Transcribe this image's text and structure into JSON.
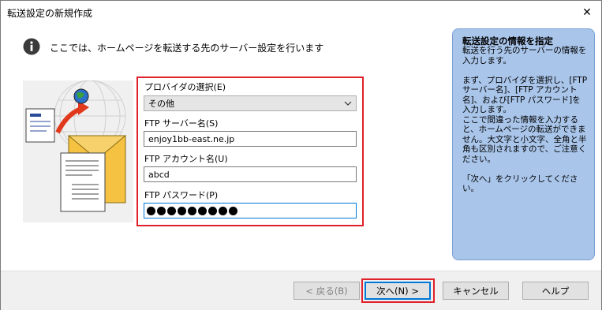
{
  "window": {
    "title": "転送設定の新規作成",
    "close_glyph": "✕"
  },
  "info": {
    "icon": "info-icon",
    "text": "ここでは、ホームページを転送する先のサーバー設定を行います"
  },
  "form": {
    "provider_label": "プロバイダの選択(E)",
    "provider_value": "その他",
    "server_label": "FTP サーバー名(S)",
    "server_value": "enjoy1bb-east.ne.jp",
    "account_label": "FTP アカウント名(U)",
    "account_value": "abcd",
    "password_label": "FTP パスワード(P)",
    "password_mask_count": 9
  },
  "help": {
    "title": "転送設定の情報を指定",
    "body": "転送を行う先のサーバーの情報を入力します。\n\nまず、プロバイダを選択し、[FTP サーバー名]、[FTP アカウント名]、および[FTP パスワード]を入力します。\nここで間違った情報を入力すると、ホームページの転送ができません。大文字と小文字、全角と半角も区別されますので、ご注意ください。\n\n「次へ」をクリックしてください。"
  },
  "buttons": {
    "back": "< 戻る(B)",
    "next": "次へ(N) >",
    "cancel": "キャンセル",
    "help": "ヘルプ"
  },
  "colors": {
    "highlight": "#e0202a",
    "help_panel": "#a9c5ea",
    "focus": "#0078d7"
  }
}
